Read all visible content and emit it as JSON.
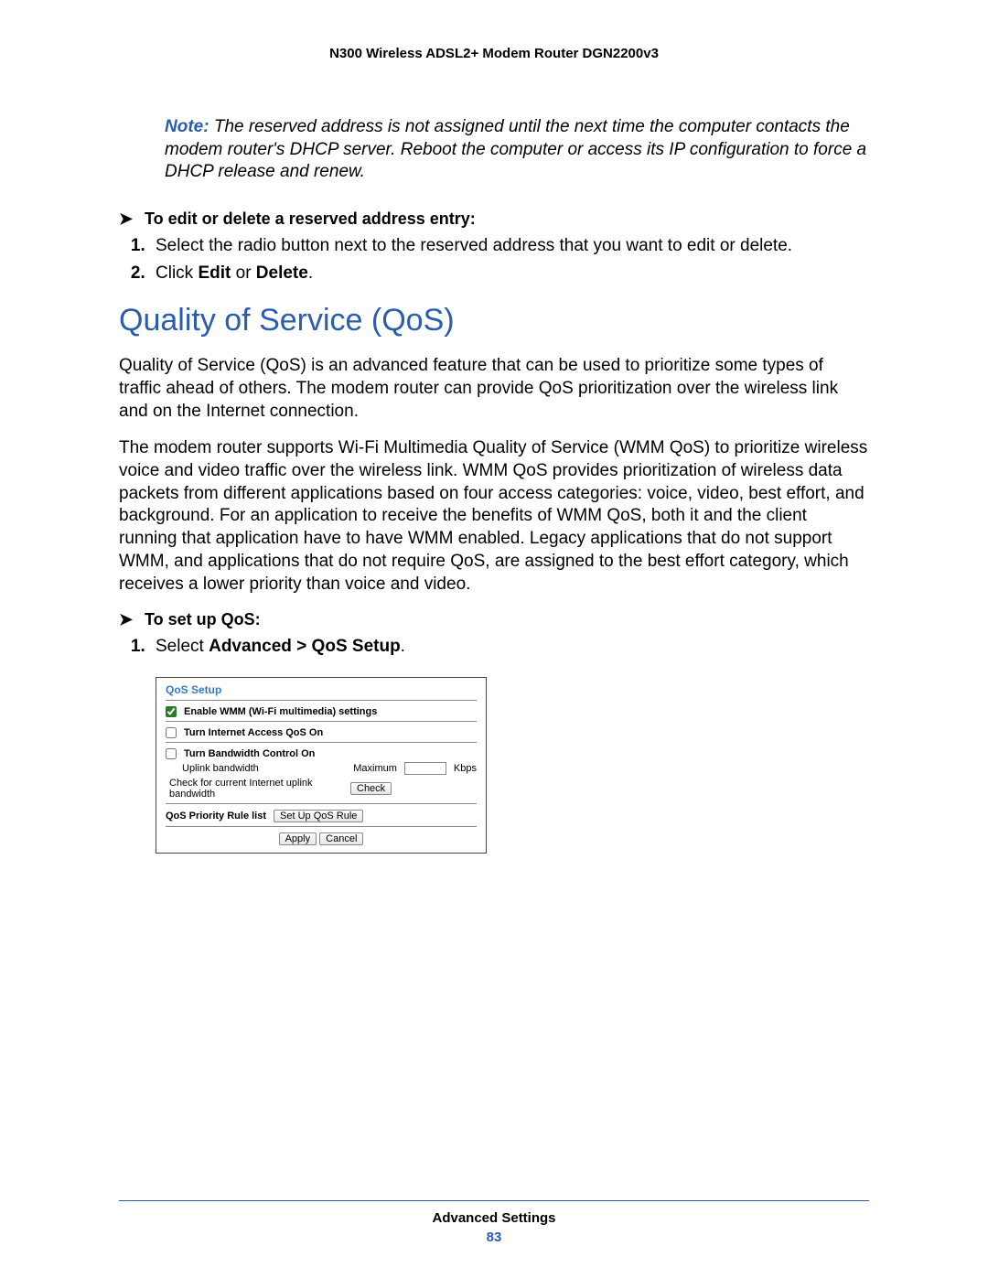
{
  "header": {
    "product": "N300 Wireless ADSL2+ Modem Router DGN2200v3"
  },
  "note": {
    "label": "Note:",
    "text": "  The reserved address is not assigned until the next time the computer contacts the modem router's DHCP server. Reboot the computer or access its IP configuration to force a DHCP release and renew."
  },
  "proc1": {
    "arrow": "➤",
    "title": "To edit or delete a reserved address entry:",
    "steps": {
      "s1": "Select the radio button next to the reserved address that you want to edit or delete.",
      "s2_pre": "Click ",
      "s2_b1": "Edit",
      "s2_mid": " or ",
      "s2_b2": "Delete",
      "s2_post": "."
    }
  },
  "section": {
    "title": "Quality of Service (QoS)"
  },
  "paras": {
    "p1": "Quality of Service (QoS) is an advanced feature that can be used to prioritize some types of traffic ahead of others. The modem router can provide QoS prioritization over the wireless link and on the Internet connection.",
    "p2": "The modem router supports Wi-Fi Multimedia Quality of Service (WMM QoS) to prioritize wireless voice and video traffic over the wireless link. WMM QoS provides prioritization of wireless data packets from different applications based on four access categories: voice, video, best effort, and background. For an application to receive the benefits of WMM QoS, both it and the client running that application have to have WMM enabled. Legacy applications that do not support WMM, and applications that do not require QoS, are assigned to the best effort category, which receives a lower priority than voice and video."
  },
  "proc2": {
    "arrow": "➤",
    "title": "To set up QoS:",
    "step1_pre": "Select ",
    "step1_b": "Advanced > QoS Setup",
    "step1_post": "."
  },
  "panel": {
    "title": "QoS Setup",
    "cb1_label": "Enable WMM (Wi-Fi multimedia) settings",
    "cb1_checked": true,
    "cb2_label": "Turn Internet Access QoS On",
    "cb2_checked": false,
    "cb3_label": "Turn Bandwidth Control On",
    "cb3_checked": false,
    "uplink_label": "Uplink bandwidth",
    "uplink_max": "Maximum",
    "uplink_unit": "Kbps",
    "check_label": "Check for current Internet uplink bandwidth",
    "check_btn": "Check",
    "rule_label": "QoS Priority Rule list",
    "rule_btn": "Set Up QoS Rule",
    "apply_btn": "Apply",
    "cancel_btn": "Cancel"
  },
  "footer": {
    "section": "Advanced Settings",
    "page": "83"
  }
}
